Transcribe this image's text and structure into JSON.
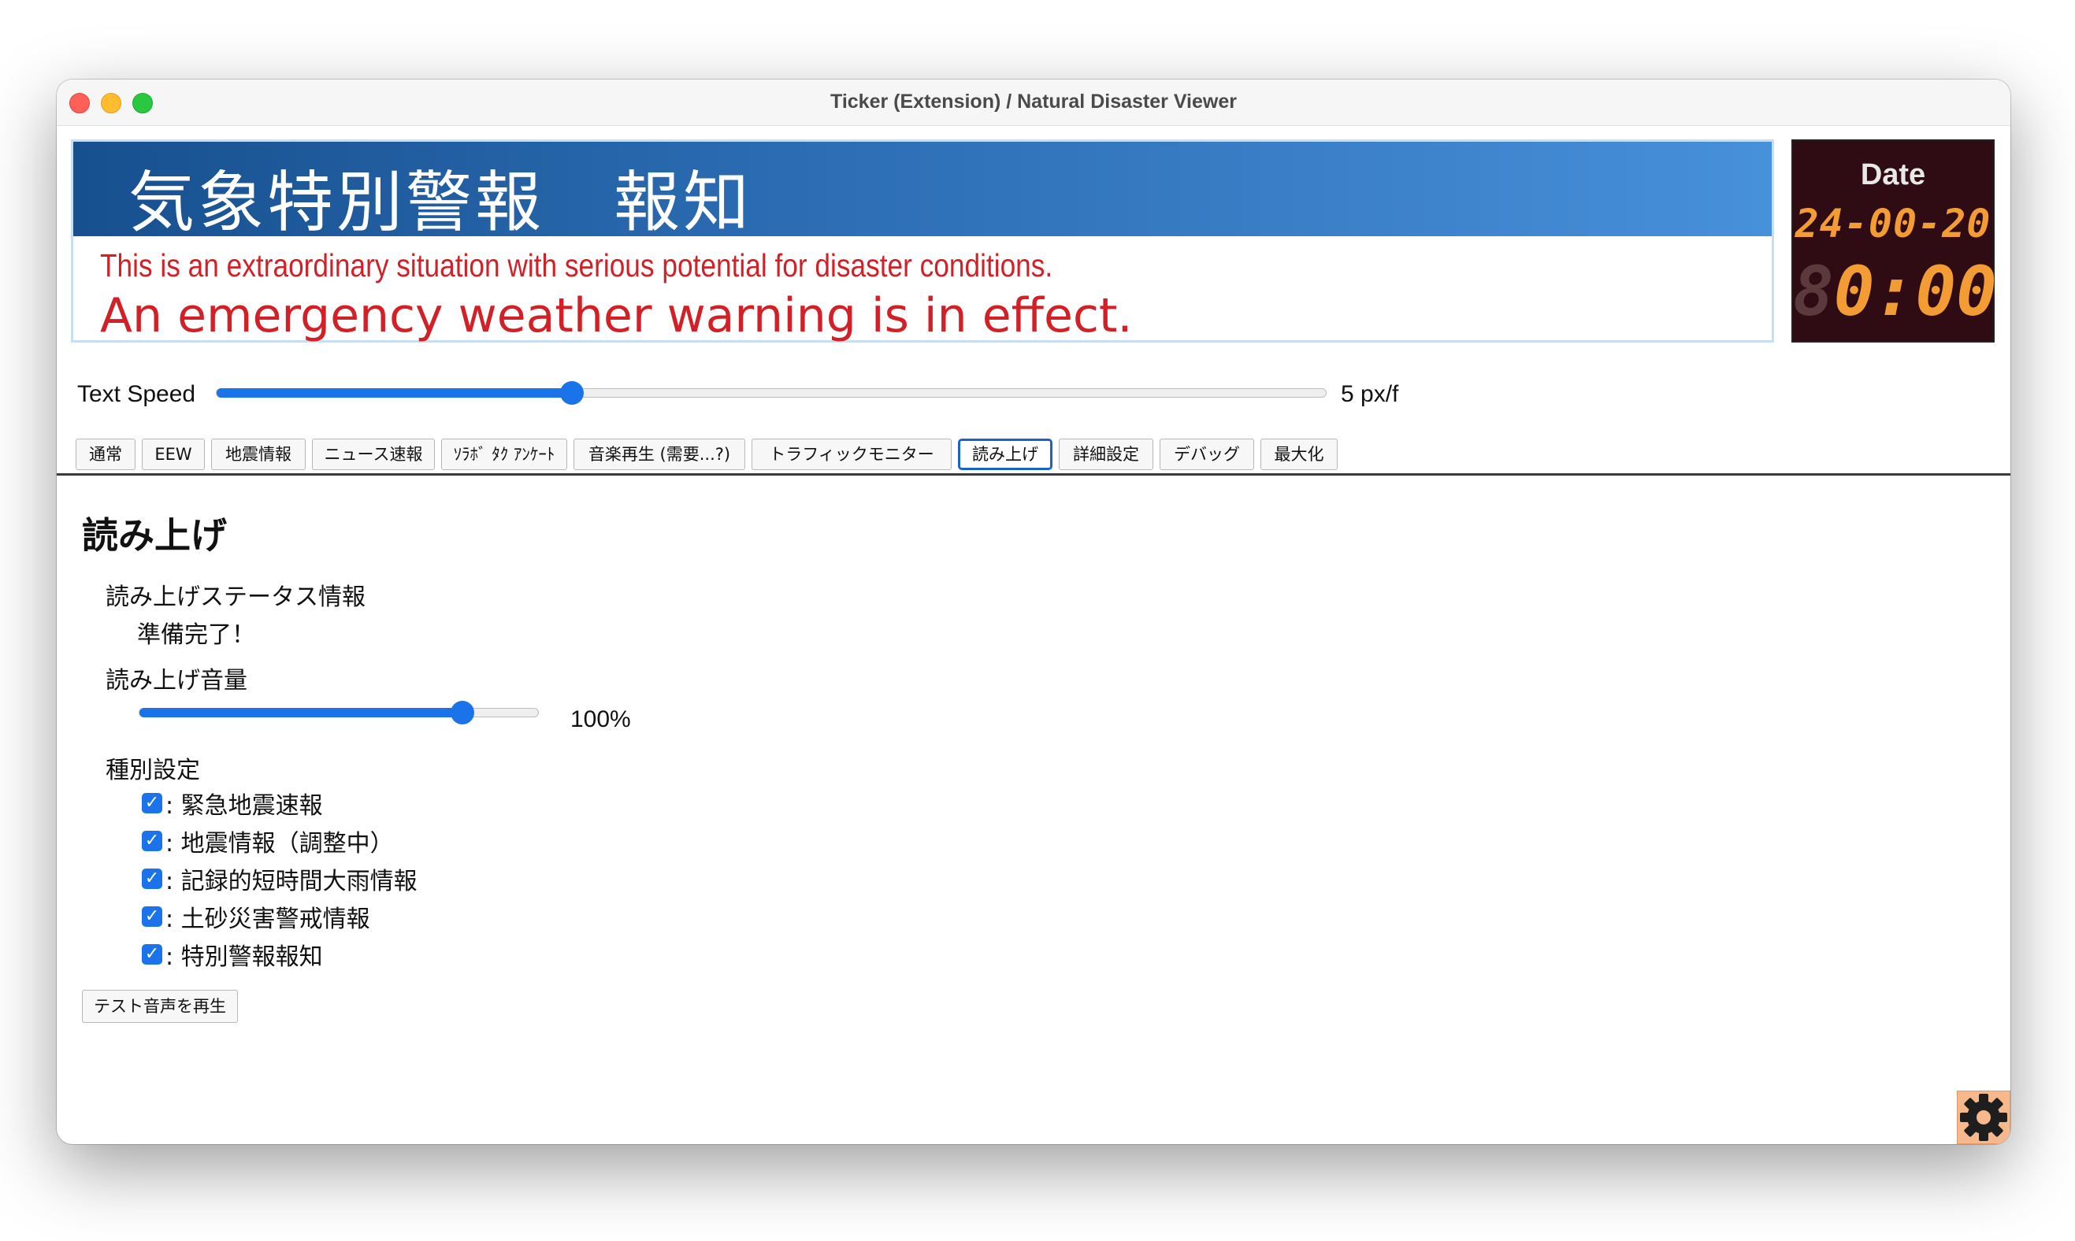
{
  "window": {
    "title": "Ticker (Extension) / Natural Disaster Viewer"
  },
  "banner": {
    "title": "気象特別警報　報知",
    "line1": "This is an extraordinary situation with serious potential for disaster conditions.",
    "line2": "An emergency weather warning is in effect.",
    "colors": {
      "header_start": "#17508f",
      "header_end": "#4790da",
      "text": "#d32026"
    }
  },
  "clock": {
    "label": "Date",
    "date": "24-00-20",
    "time_ghost": "8",
    "time": "0:00",
    "colors": {
      "digits": "#f39c33",
      "background": "#2f0c14"
    }
  },
  "speed": {
    "label": "Text Speed",
    "value_text": "5 px/f",
    "fraction": 0.32
  },
  "tabs": [
    {
      "label": "通常"
    },
    {
      "label": "EEW"
    },
    {
      "label": "地震情報"
    },
    {
      "label": "ニュース速報"
    },
    {
      "label": "ｿﾗﾎﾞ ﾀｸ ｱﾝｹｰﾄ"
    },
    {
      "label": "音楽再生 (需要...?)"
    },
    {
      "label": "トラフィックモニター"
    },
    {
      "label": "読み上げ",
      "active": true
    },
    {
      "label": "詳細設定"
    },
    {
      "label": "デバッグ"
    },
    {
      "label": "最大化"
    }
  ],
  "panel": {
    "heading": "読み上げ",
    "status_label": "読み上げステータス情報",
    "status_value": "準備完了！",
    "volume_label": "読み上げ音量",
    "volume_value": "100%",
    "volume_fraction": 0.81,
    "types_label": "種別設定",
    "types": [
      {
        "label": ": 緊急地震速報",
        "checked": true
      },
      {
        "label": ": 地震情報（調整中）",
        "checked": true
      },
      {
        "label": ": 記録的短時間大雨情報",
        "checked": true
      },
      {
        "label": ": 土砂災害警戒情報",
        "checked": true
      },
      {
        "label": ": 特別警報報知",
        "checked": true
      }
    ],
    "test_button": "テスト音声を再生"
  },
  "icons": {
    "settings": "gear-icon",
    "check": "checkmark-icon"
  },
  "accent_color": "#1a73e8"
}
